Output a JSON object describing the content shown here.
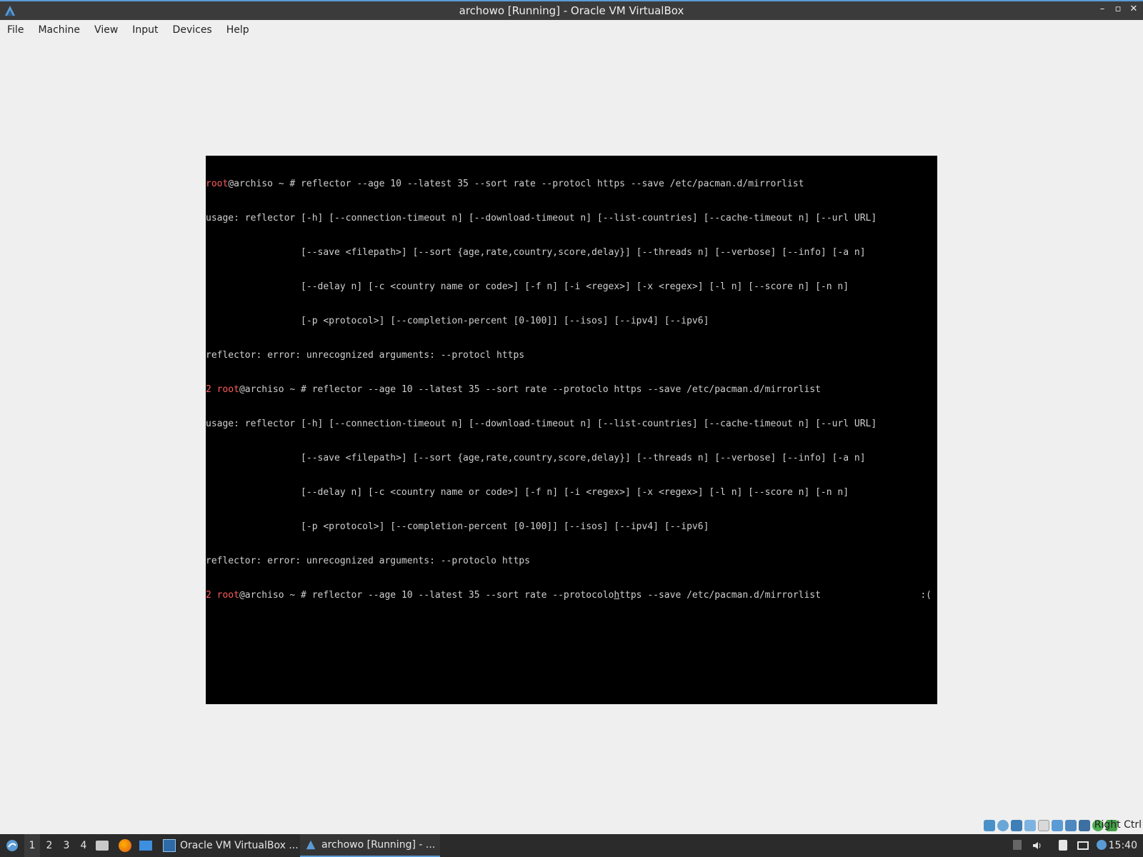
{
  "window": {
    "title": "archowo [Running] - Oracle VM VirtualBox",
    "controls": [
      "–",
      "▫",
      "✕"
    ]
  },
  "menubar": [
    "File",
    "Machine",
    "View",
    "Input",
    "Devices",
    "Help"
  ],
  "terminal": {
    "lines": [
      {
        "red": "root",
        "rest": "@archiso ~ # reflector --age 10 --latest 35 --sort rate --protocl https --save /etc/pacman.d/mirrorlist"
      },
      {
        "red": "",
        "rest": "usage: reflector [-h] [--connection-timeout n] [--download-timeout n] [--list-countries] [--cache-timeout n] [--url URL]"
      },
      {
        "red": "",
        "rest": "                 [--save <filepath>] [--sort {age,rate,country,score,delay}] [--threads n] [--verbose] [--info] [-a n]"
      },
      {
        "red": "",
        "rest": "                 [--delay n] [-c <country name or code>] [-f n] [-i <regex>] [-x <regex>] [-l n] [--score n] [-n n]"
      },
      {
        "red": "",
        "rest": "                 [-p <protocol>] [--completion-percent [0-100]] [--isos] [--ipv4] [--ipv6]"
      },
      {
        "red": "",
        "rest": "reflector: error: unrecognized arguments: --protocl https"
      },
      {
        "red": "2 root",
        "rest": "@archiso ~ # reflector --age 10 --latest 35 --sort rate --protoclo https --save /etc/pacman.d/mirrorlist"
      },
      {
        "red": "",
        "rest": "usage: reflector [-h] [--connection-timeout n] [--download-timeout n] [--list-countries] [--cache-timeout n] [--url URL]"
      },
      {
        "red": "",
        "rest": "                 [--save <filepath>] [--sort {age,rate,country,score,delay}] [--threads n] [--verbose] [--info] [-a n]"
      },
      {
        "red": "",
        "rest": "                 [--delay n] [-c <country name or code>] [-f n] [-i <regex>] [-x <regex>] [-l n] [--score n] [-n n]"
      },
      {
        "red": "",
        "rest": "                 [-p <protocol>] [--completion-percent [0-100]] [--isos] [--ipv4] [--ipv6]"
      },
      {
        "red": "",
        "rest": "reflector: error: unrecognized arguments: --protoclo https"
      }
    ],
    "current": {
      "red": "2 root",
      "before_cursor": "@archiso ~ # reflector --age 10 --latest 35 --sort rate --protocolo",
      "cursor_char": "h",
      "after_cursor": "ttps --save /etc/pacman.d/mirrorlist",
      "right_status": ":("
    }
  },
  "statusbar": {
    "host_key": "Right Ctrl",
    "icons": [
      "hard-disk-icon",
      "optical-disk-icon",
      "network-icon",
      "usb-icon",
      "shared-folder-icon",
      "display-icon",
      "recording-icon",
      "cpu-icon",
      "mouse-integration-icon",
      "keyboard-icon"
    ]
  },
  "taskbar": {
    "workspaces": [
      "1",
      "2",
      "3",
      "4"
    ],
    "active_workspace": "1",
    "tasks": [
      {
        "label": "Oracle VM VirtualBox ...",
        "active": false
      },
      {
        "label": "archowo [Running] - ...",
        "active": true
      }
    ],
    "clock": "15:40"
  },
  "colors": {
    "accent": "#5b9bd5",
    "prompt_red": "#ff5c5c",
    "terminal_bg": "#000000",
    "terminal_fg": "#cfcfcf"
  }
}
